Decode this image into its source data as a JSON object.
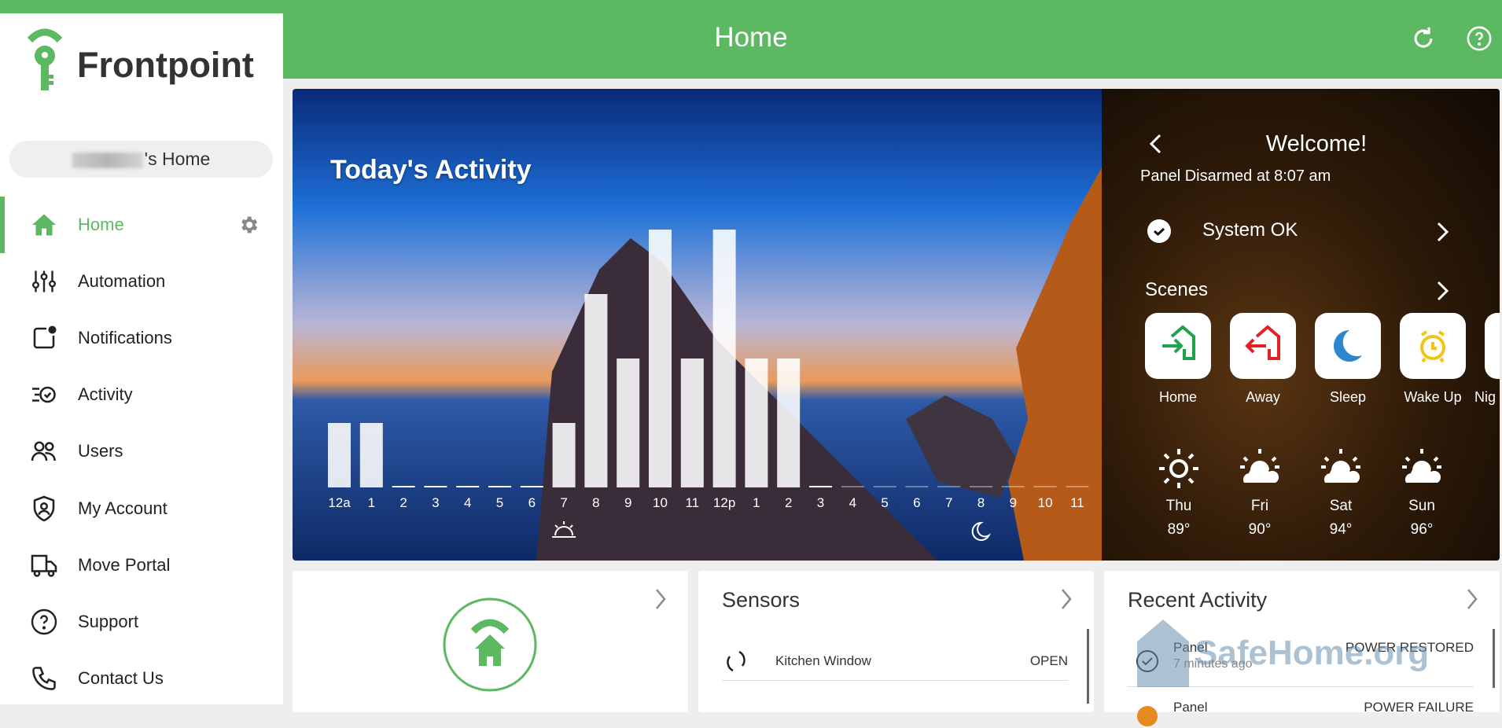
{
  "header": {
    "title": "Home",
    "refresh_icon": "refresh-icon",
    "help_icon": "help-icon"
  },
  "brand": {
    "name": "Frontpoint",
    "color": "#5cb962"
  },
  "sidebar": {
    "home_selector": "'s Home",
    "items": [
      {
        "label": "Home",
        "icon": "home-icon",
        "active": true
      },
      {
        "label": "Automation",
        "icon": "sliders-icon"
      },
      {
        "label": "Notifications",
        "icon": "notification-icon"
      },
      {
        "label": "Activity",
        "icon": "activity-icon"
      },
      {
        "label": "Users",
        "icon": "users-icon"
      },
      {
        "label": "My Account",
        "icon": "shield-user-icon"
      },
      {
        "label": "Move Portal",
        "icon": "truck-icon"
      },
      {
        "label": "Support",
        "icon": "question-icon"
      },
      {
        "label": "Contact Us",
        "icon": "phone-icon"
      }
    ]
  },
  "hero": {
    "title": "Today's Activity"
  },
  "chart_data": {
    "type": "bar",
    "title": "Today's Activity",
    "categories": [
      "12a",
      "1",
      "2",
      "3",
      "4",
      "5",
      "6",
      "7",
      "8",
      "9",
      "10",
      "11",
      "12p",
      "1",
      "2",
      "3",
      "4",
      "5",
      "6",
      "7",
      "8",
      "9",
      "10",
      "11"
    ],
    "values": [
      1,
      1,
      0,
      0,
      0,
      0,
      0,
      1,
      3,
      2,
      4,
      2,
      4,
      2,
      2,
      0,
      null,
      null,
      null,
      null,
      null,
      null,
      null,
      null
    ],
    "markers": {
      "sunrise_at": "7",
      "sunset_at": "8 (pm)"
    },
    "grid": false
  },
  "welcome": {
    "title": "Welcome!",
    "status": "Panel Disarmed at 8:07 am",
    "system": "System OK",
    "scenes_label": "Scenes",
    "scenes": [
      {
        "label": "Home",
        "color": "#1fa34a"
      },
      {
        "label": "Away",
        "color": "#e02424"
      },
      {
        "label": "Sleep",
        "color": "#2d87cf"
      },
      {
        "label": "Wake Up",
        "color": "#f2c417"
      },
      {
        "label": "Nig"
      }
    ],
    "weather": [
      {
        "day": "Thu",
        "temp": "89°",
        "icon": "sun-icon"
      },
      {
        "day": "Fri",
        "temp": "90°",
        "icon": "partly-cloudy-icon"
      },
      {
        "day": "Sat",
        "temp": "94°",
        "icon": "partly-cloudy-icon"
      },
      {
        "day": "Sun",
        "temp": "96°",
        "icon": "partly-cloudy-icon"
      }
    ]
  },
  "sensors": {
    "title": "Sensors",
    "items": [
      {
        "name": "Kitchen Window",
        "state": "OPEN"
      }
    ]
  },
  "recent": {
    "title": "Recent Activity",
    "items": [
      {
        "source": "Panel",
        "event": "POWER RESTORED",
        "time": "7 minutes ago"
      },
      {
        "source": "Panel",
        "event": "POWER FAILURE"
      }
    ]
  },
  "watermark": "SafeHome.org"
}
